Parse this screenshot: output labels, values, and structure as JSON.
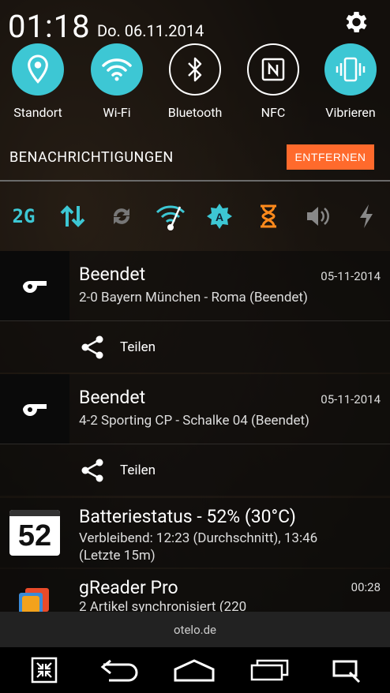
{
  "status": {
    "clock": "01:18",
    "date": "Do. 06.11.2014"
  },
  "quick_settings": [
    {
      "label": "Standort",
      "icon": "location-icon",
      "active": true
    },
    {
      "label": "Wi-Fi",
      "icon": "wifi-icon",
      "active": true
    },
    {
      "label": "Bluetooth",
      "icon": "bluetooth-icon",
      "active": false
    },
    {
      "label": "NFC",
      "icon": "nfc-icon",
      "active": false
    },
    {
      "label": "Vibrieren",
      "icon": "vibrate-icon",
      "active": true
    }
  ],
  "notifications_header": {
    "title": "BENACHRICHTIGUNGEN",
    "clear_label": "ENTFERNEN",
    "clear_color": "#ff6a2c"
  },
  "status_icons": {
    "network_label": "2G"
  },
  "notifications": [
    {
      "title": "Beendet",
      "text": "2-0 Bayern München - Roma (Beendet)",
      "time": "05-11-2014",
      "action": "Teilen"
    },
    {
      "title": "Beendet",
      "text": "4-2 Sporting CP - Schalke 04 (Beendet)",
      "time": "05-11-2014",
      "action": "Teilen"
    },
    {
      "title": "Batteriestatus - 52% (30°C)",
      "line1": "Verbleibend: 12:23 (Durchschnitt), 13:46",
      "line2": "(Letzte 15m)",
      "badge": "52"
    },
    {
      "title": "gReader Pro",
      "text": "2 Artikel synchronisiert (220",
      "time": "00:28"
    }
  ],
  "carrier": "otelo.de",
  "accent": "#3dc7d4"
}
